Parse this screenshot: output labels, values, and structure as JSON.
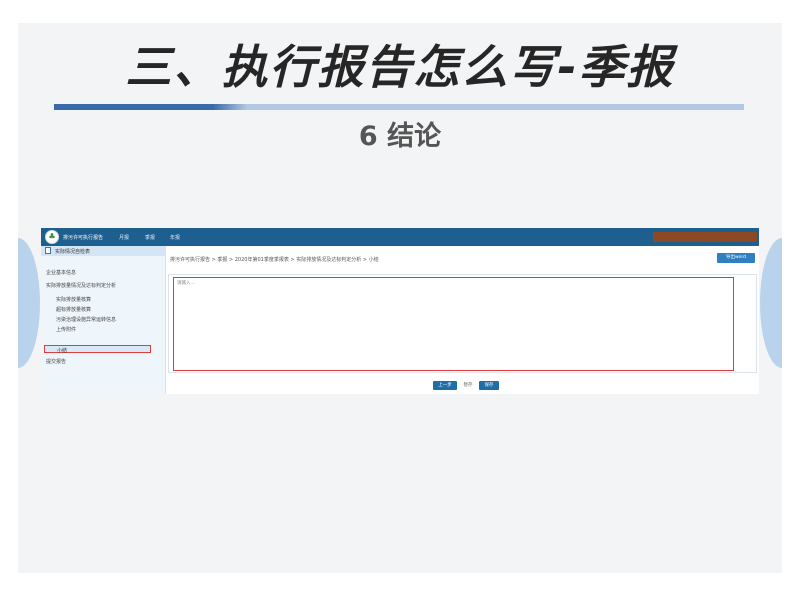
{
  "slide": {
    "title": "三、执行报告怎么写-季报",
    "subtitle": "6 结论"
  },
  "app": {
    "name": "排污许可执行报告",
    "nav": [
      "月报",
      "季报",
      "年报"
    ],
    "sidebar": {
      "header": "实际情况自检表",
      "items": [
        "企业基本信息",
        "实际排放量情况及达标判定分析",
        "实际排放量核算",
        "超标排放量核算",
        "污染治理设施异常运转信息",
        "上传附件",
        "小结",
        "提交报告"
      ]
    },
    "breadcrumb": "排污许可执行报告 > 季报 > 2020年第01季度季报表 > 实际排放情况及达标判定分析 > 小结",
    "export_button": "导出word",
    "editor_placeholder": "请输入...",
    "buttons": {
      "prev": "上一步",
      "save": "暂存",
      "next": "保存"
    }
  },
  "colors": {
    "topbar": "#1d5f8f",
    "accent": "#3a6aa8",
    "highlight_border": "#e03c3c",
    "button": "#1e6ea8"
  }
}
